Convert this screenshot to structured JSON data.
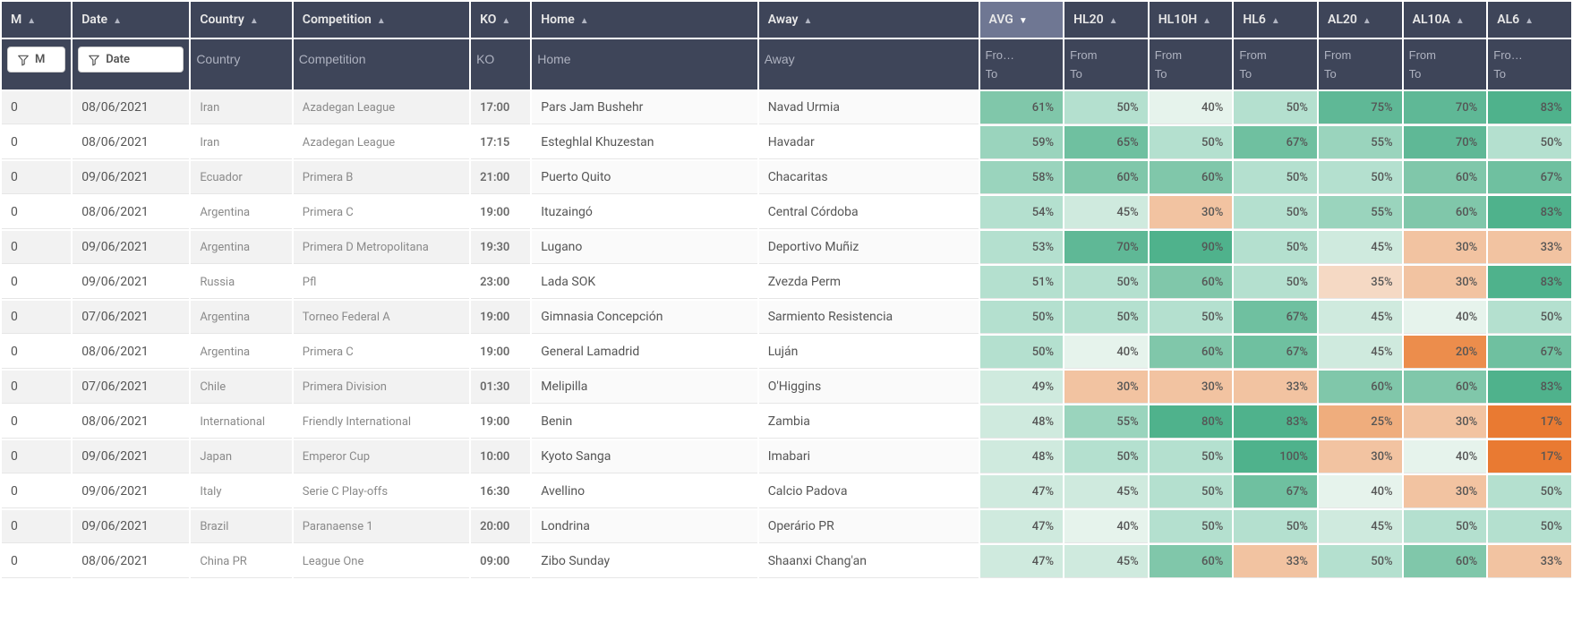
{
  "columns": [
    {
      "key": "m",
      "label": "M",
      "sort": "asc",
      "width": "col-M",
      "filter_type": "button",
      "filter_label": "M"
    },
    {
      "key": "date",
      "label": "Date",
      "sort": "asc",
      "width": "col-Date",
      "filter_type": "button",
      "filter_label": "Date"
    },
    {
      "key": "country",
      "label": "Country",
      "sort": "asc",
      "width": "col-Country",
      "filter_type": "text",
      "placeholder": "Country"
    },
    {
      "key": "competition",
      "label": "Competition",
      "sort": "asc",
      "width": "col-Comp",
      "filter_type": "text",
      "placeholder": "Competition"
    },
    {
      "key": "ko",
      "label": "KO",
      "sort": "asc",
      "width": "col-KO",
      "filter_type": "text",
      "placeholder": "KO"
    },
    {
      "key": "home",
      "label": "Home",
      "sort": "asc",
      "width": "col-Home",
      "filter_type": "text",
      "placeholder": "Home"
    },
    {
      "key": "away",
      "label": "Away",
      "sort": "asc",
      "width": "col-Away",
      "filter_type": "text",
      "placeholder": "Away"
    },
    {
      "key": "avg",
      "label": "AVG",
      "sort": "desc",
      "width": "col-Num",
      "filter_type": "range",
      "sorted": true
    },
    {
      "key": "hl20",
      "label": "HL20",
      "sort": "asc",
      "width": "col-Num",
      "filter_type": "range"
    },
    {
      "key": "hl10h",
      "label": "HL10H",
      "sort": "asc",
      "width": "col-Num",
      "filter_type": "range"
    },
    {
      "key": "hl6",
      "label": "HL6",
      "sort": "asc",
      "width": "col-Num",
      "filter_type": "range"
    },
    {
      "key": "al20",
      "label": "AL20",
      "sort": "asc",
      "width": "col-Num",
      "filter_type": "range"
    },
    {
      "key": "al10a",
      "label": "AL10A",
      "sort": "asc",
      "width": "col-Num",
      "filter_type": "range"
    },
    {
      "key": "al6",
      "label": "AL6",
      "sort": "asc",
      "width": "col-Num",
      "filter_type": "range"
    }
  ],
  "range_placeholders": {
    "from": "From",
    "to": "To",
    "from_short": "Fro…"
  },
  "rows": [
    {
      "m": "0",
      "date": "08/06/2021",
      "country": "Iran",
      "competition": "Azadegan League",
      "ko": "17:00",
      "home": "Pars Jam Bushehr",
      "away": "Navad Urmia",
      "avg": 61,
      "hl20": 50,
      "hl10h": 40,
      "hl6": 50,
      "al20": 75,
      "al10a": 70,
      "al6": 83
    },
    {
      "m": "0",
      "date": "08/06/2021",
      "country": "Iran",
      "competition": "Azadegan League",
      "ko": "17:15",
      "home": "Esteghlal Khuzestan",
      "away": "Havadar",
      "avg": 59,
      "hl20": 65,
      "hl10h": 50,
      "hl6": 67,
      "al20": 55,
      "al10a": 70,
      "al6": 50
    },
    {
      "m": "0",
      "date": "09/06/2021",
      "country": "Ecuador",
      "competition": "Primera B",
      "ko": "21:00",
      "home": "Puerto Quito",
      "away": "Chacaritas",
      "avg": 58,
      "hl20": 60,
      "hl10h": 60,
      "hl6": 50,
      "al20": 50,
      "al10a": 60,
      "al6": 67
    },
    {
      "m": "0",
      "date": "08/06/2021",
      "country": "Argentina",
      "competition": "Primera C",
      "ko": "19:00",
      "home": "Ituzaingó",
      "away": "Central Córdoba",
      "avg": 54,
      "hl20": 45,
      "hl10h": 30,
      "hl6": 50,
      "al20": 55,
      "al10a": 60,
      "al6": 83
    },
    {
      "m": "0",
      "date": "09/06/2021",
      "country": "Argentina",
      "competition": "Primera D Metropolitana",
      "ko": "19:30",
      "home": "Lugano",
      "away": "Deportivo Muñiz",
      "avg": 53,
      "hl20": 70,
      "hl10h": 90,
      "hl6": 50,
      "al20": 45,
      "al10a": 30,
      "al6": 33
    },
    {
      "m": "0",
      "date": "09/06/2021",
      "country": "Russia",
      "competition": "Pfl",
      "ko": "23:00",
      "home": "Lada SOK",
      "away": "Zvezda Perm",
      "avg": 51,
      "hl20": 50,
      "hl10h": 60,
      "hl6": 50,
      "al20": 35,
      "al10a": 30,
      "al6": 83
    },
    {
      "m": "0",
      "date": "07/06/2021",
      "country": "Argentina",
      "competition": "Torneo Federal A",
      "ko": "19:00",
      "home": "Gimnasia Concepción",
      "away": "Sarmiento Resistencia",
      "avg": 50,
      "hl20": 50,
      "hl10h": 50,
      "hl6": 67,
      "al20": 45,
      "al10a": 40,
      "al6": 50
    },
    {
      "m": "0",
      "date": "08/06/2021",
      "country": "Argentina",
      "competition": "Primera C",
      "ko": "19:00",
      "home": "General Lamadrid",
      "away": "Luján",
      "avg": 50,
      "hl20": 40,
      "hl10h": 60,
      "hl6": 67,
      "al20": 45,
      "al10a": 20,
      "al6": 67
    },
    {
      "m": "0",
      "date": "07/06/2021",
      "country": "Chile",
      "competition": "Primera Division",
      "ko": "01:30",
      "home": "Melipilla",
      "away": "O'Higgins",
      "avg": 49,
      "hl20": 30,
      "hl10h": 30,
      "hl6": 33,
      "al20": 60,
      "al10a": 60,
      "al6": 83
    },
    {
      "m": "0",
      "date": "08/06/2021",
      "country": "International",
      "competition": "Friendly International",
      "ko": "19:00",
      "home": "Benin",
      "away": "Zambia",
      "avg": 48,
      "hl20": 55,
      "hl10h": 80,
      "hl6": 83,
      "al20": 25,
      "al10a": 30,
      "al6": 17
    },
    {
      "m": "0",
      "date": "09/06/2021",
      "country": "Japan",
      "competition": "Emperor Cup",
      "ko": "10:00",
      "home": "Kyoto Sanga",
      "away": "Imabari",
      "avg": 48,
      "hl20": 50,
      "hl10h": 50,
      "hl6": 100,
      "al20": 30,
      "al10a": 40,
      "al6": 17
    },
    {
      "m": "0",
      "date": "09/06/2021",
      "country": "Italy",
      "competition": "Serie C Play-offs",
      "ko": "16:30",
      "home": "Avellino",
      "away": "Calcio Padova",
      "avg": 47,
      "hl20": 45,
      "hl10h": 50,
      "hl6": 67,
      "al20": 40,
      "al10a": 30,
      "al6": 50
    },
    {
      "m": "0",
      "date": "09/06/2021",
      "country": "Brazil",
      "competition": "Paranaense 1",
      "ko": "20:00",
      "home": "Londrina",
      "away": "Operário PR",
      "avg": 47,
      "hl20": 40,
      "hl10h": 50,
      "hl6": 50,
      "al20": 45,
      "al10a": 50,
      "al6": 50
    },
    {
      "m": "0",
      "date": "08/06/2021",
      "country": "China PR",
      "competition": "League One",
      "ko": "09:00",
      "home": "Zibo Sunday",
      "away": "Shaanxi Chang'an",
      "avg": 47,
      "hl20": 45,
      "hl10h": 60,
      "hl6": 33,
      "al20": 50,
      "al10a": 60,
      "al6": 33
    }
  ]
}
